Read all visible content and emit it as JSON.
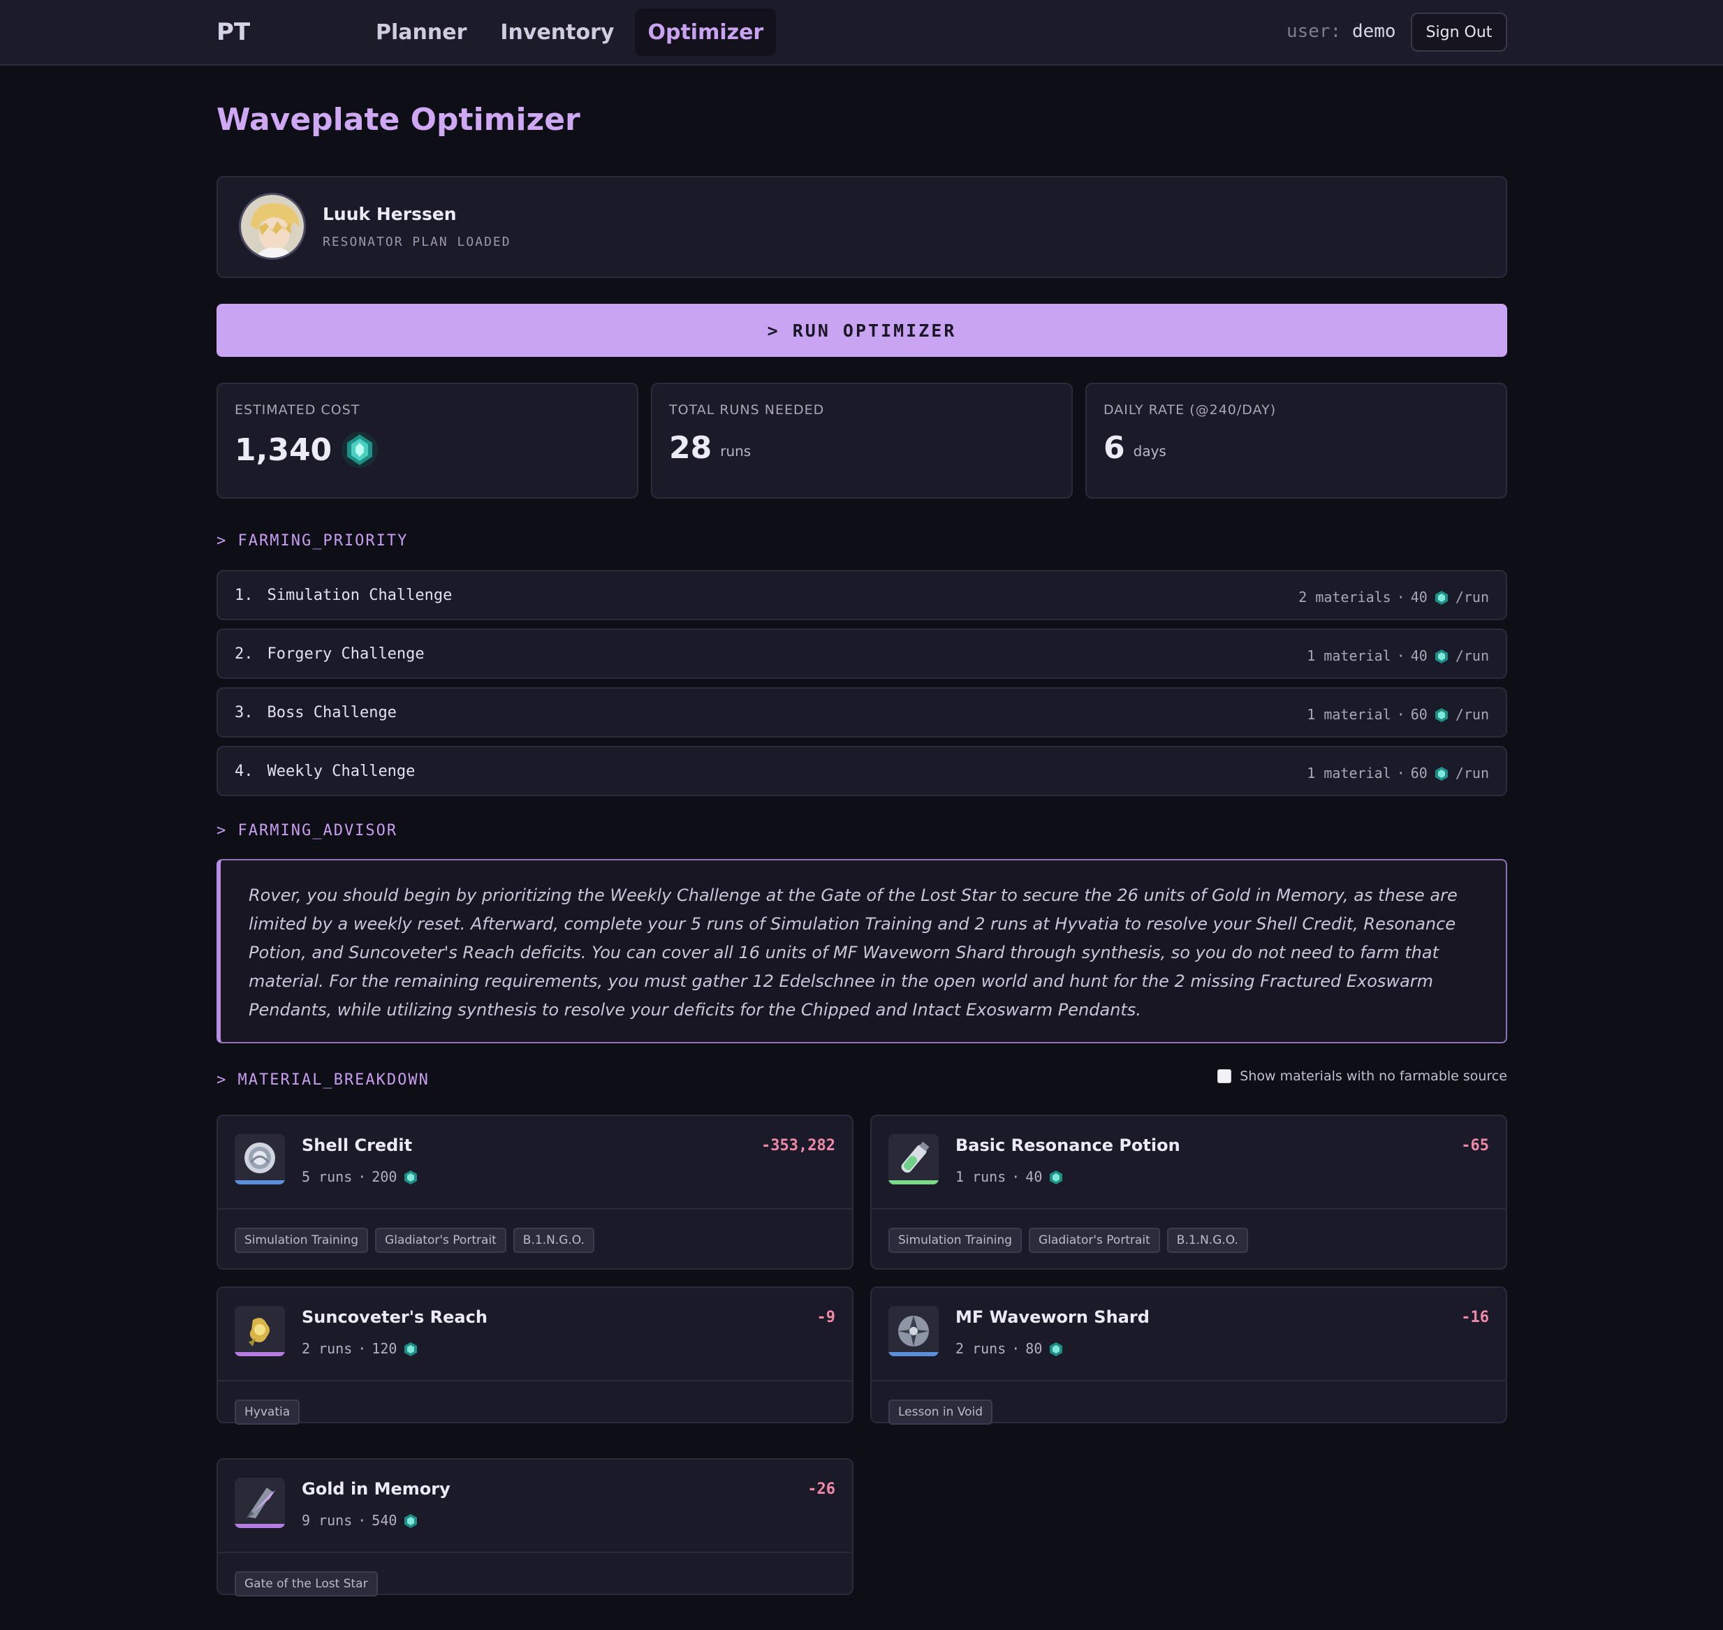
{
  "app": {
    "logo": "PT"
  },
  "nav": {
    "items": [
      {
        "label": "Planner"
      },
      {
        "label": "Inventory"
      },
      {
        "label": "Optimizer"
      }
    ]
  },
  "user": {
    "key": "user:",
    "name": "demo",
    "signout_label": "Sign Out"
  },
  "page": {
    "title": "Waveplate Optimizer"
  },
  "profile": {
    "name": "Luuk Herssen",
    "status": "RESONATOR PLAN LOADED"
  },
  "optimizer": {
    "run_label": "> RUN OPTIMIZER"
  },
  "stats": [
    {
      "label": "ESTIMATED COST",
      "value": "1,340",
      "unit": ""
    },
    {
      "label": "TOTAL RUNS NEEDED",
      "value": "28",
      "unit": "runs"
    },
    {
      "label": "DAILY RATE (@240/DAY)",
      "value": "6",
      "unit": "days"
    }
  ],
  "priority": {
    "heading": "> FARMING_PRIORITY",
    "rows": [
      {
        "num": "1.",
        "name": "Simulation Challenge",
        "materials": "2 materials",
        "cost": "40",
        "per": "/run"
      },
      {
        "num": "2.",
        "name": "Forgery Challenge",
        "materials": "1 material",
        "cost": "40",
        "per": "/run"
      },
      {
        "num": "3.",
        "name": "Boss Challenge",
        "materials": "1 material",
        "cost": "60",
        "per": "/run"
      },
      {
        "num": "4.",
        "name": "Weekly Challenge",
        "materials": "1 material",
        "cost": "60",
        "per": "/run"
      }
    ]
  },
  "advisor": {
    "heading": "> FARMING_ADVISOR",
    "text": "Rover, you should begin by prioritizing the Weekly Challenge at the Gate of the Lost Star to secure the 26 units of Gold in Memory, as these are limited by a weekly reset. Afterward, complete your 5 runs of Simulation Training and 2 runs at Hyvatia to resolve your Shell Credit, Resonance Potion, and Suncoveter's Reach deficits. You can cover all 16 units of MF Waveworn Shard through synthesis, so you do not need to farm that material. For the remaining requirements, you must gather 12 Edelschnee in the open world and hunt for the 2 missing Fractured Exoswarm Pendants, while utilizing synthesis to resolve your deficits for the Chipped and Intact Exoswarm Pendants."
  },
  "breakdown": {
    "heading": "> MATERIAL_BREAKDOWN",
    "toggle_label": "Show materials with no farmable source",
    "materials": [
      {
        "name": "Shell Credit",
        "runs": "5 runs",
        "cost": "200",
        "deficit": "-353,282",
        "tags": [
          "Simulation Training",
          "Gladiator's Portrait",
          "B.1.N.G.O."
        ],
        "rarity_color": "#5b8fd9"
      },
      {
        "name": "Basic Resonance Potion",
        "runs": "1 runs",
        "cost": "40",
        "deficit": "-65",
        "tags": [
          "Simulation Training",
          "Gladiator's Portrait",
          "B.1.N.G.O."
        ],
        "rarity_color": "#7cd98a"
      },
      {
        "name": "Suncoveter's Reach",
        "runs": "2 runs",
        "cost": "120",
        "deficit": "-9",
        "tags": [
          "Hyvatia"
        ],
        "rarity_color": "#b67de0"
      },
      {
        "name": "MF Waveworn Shard",
        "runs": "2 runs",
        "cost": "80",
        "deficit": "-16",
        "tags": [
          "Lesson in Void"
        ],
        "rarity_color": "#5b8fd9"
      },
      {
        "name": "Gold in Memory",
        "runs": "9 runs",
        "cost": "540",
        "deficit": "-26",
        "tags": [
          "Gate of the Lost Star"
        ],
        "rarity_color": "#b67de0"
      }
    ]
  },
  "colors": {
    "accent": "#c9a4f2",
    "deficit": "#f08aa7",
    "background": "#0e0e16",
    "card": "#1b1a28"
  },
  "icons": {
    "currency": "waveplate-icon"
  }
}
